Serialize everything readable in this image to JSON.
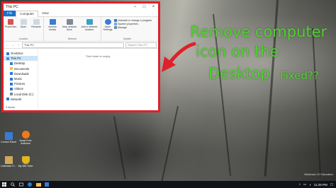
{
  "overlay": {
    "line1": "Remove computer",
    "line2": "icon on the",
    "line3": "Desktop",
    "line4": "Fixed??",
    "color": "#4dd32c"
  },
  "window": {
    "title": "This PC",
    "tabs": [
      "File",
      "Computer",
      "View"
    ],
    "ribbon": {
      "location": {
        "label": "Location",
        "items": [
          "Properties",
          "Open",
          "Rename"
        ]
      },
      "network": {
        "label": "Network",
        "items": [
          "Access media",
          "Map network drive",
          "Add a network location"
        ]
      },
      "system": {
        "label": "System",
        "open_settings": "Open Settings",
        "items": [
          "Uninstall or change a program",
          "System properties",
          "Manage"
        ]
      }
    },
    "address": "This PC",
    "search_placeholder": "Search This PC",
    "nav": [
      {
        "label": "OneDrive",
        "color": "#2a7bd6"
      },
      {
        "label": "This PC",
        "color": "#3d8fe0",
        "selected": true
      },
      {
        "label": "Desktop",
        "color": "#3a7bd5"
      },
      {
        "label": "Documents",
        "color": "#f0c24a"
      },
      {
        "label": "Downloads",
        "color": "#2a7bd6"
      },
      {
        "label": "Music",
        "color": "#2a7bd6"
      },
      {
        "label": "Pictures",
        "color": "#2a7bd6"
      },
      {
        "label": "Videos",
        "color": "#2a7bd6"
      },
      {
        "label": "Local Disk (C:)",
        "color": "#888888"
      },
      {
        "label": "Network",
        "color": "#2a7bd6"
      }
    ],
    "empty_text": "This folder is empty.",
    "status": "0 items"
  },
  "desktop_icons": [
    {
      "label": "Control Panel",
      "color": "#3a7bd5"
    },
    {
      "label": "Avast Free Antivirus",
      "color": "#f07a1a"
    },
    {
      "label": "Unknown H...",
      "color": "#cfa85a"
    },
    {
      "label": "My 365 Tube",
      "color": "#e0b81e"
    }
  ],
  "watermark": "Windows 10 Education",
  "taskbar": {
    "time": "11:29 PM",
    "date": "",
    "accent": "#101418"
  }
}
